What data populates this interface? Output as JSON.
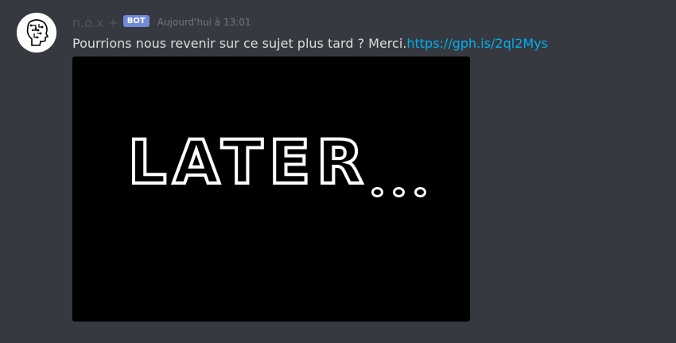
{
  "message": {
    "username": "n.o.x +",
    "bot_tag": "BOT",
    "timestamp": "Aujourd'hui à 13:01",
    "text": "Pourrions nous revenir sur ce sujet plus tard ? Merci.",
    "link": "https://gph.is/2ql2Mys"
  },
  "embed": {
    "gif_text": "LATER"
  },
  "colors": {
    "background": "#36393f",
    "link": "#00b0f4",
    "bot_tag": "#7289da",
    "username": "#4f545c"
  },
  "icons": {
    "avatar": "robot-head-circuit-avatar"
  }
}
